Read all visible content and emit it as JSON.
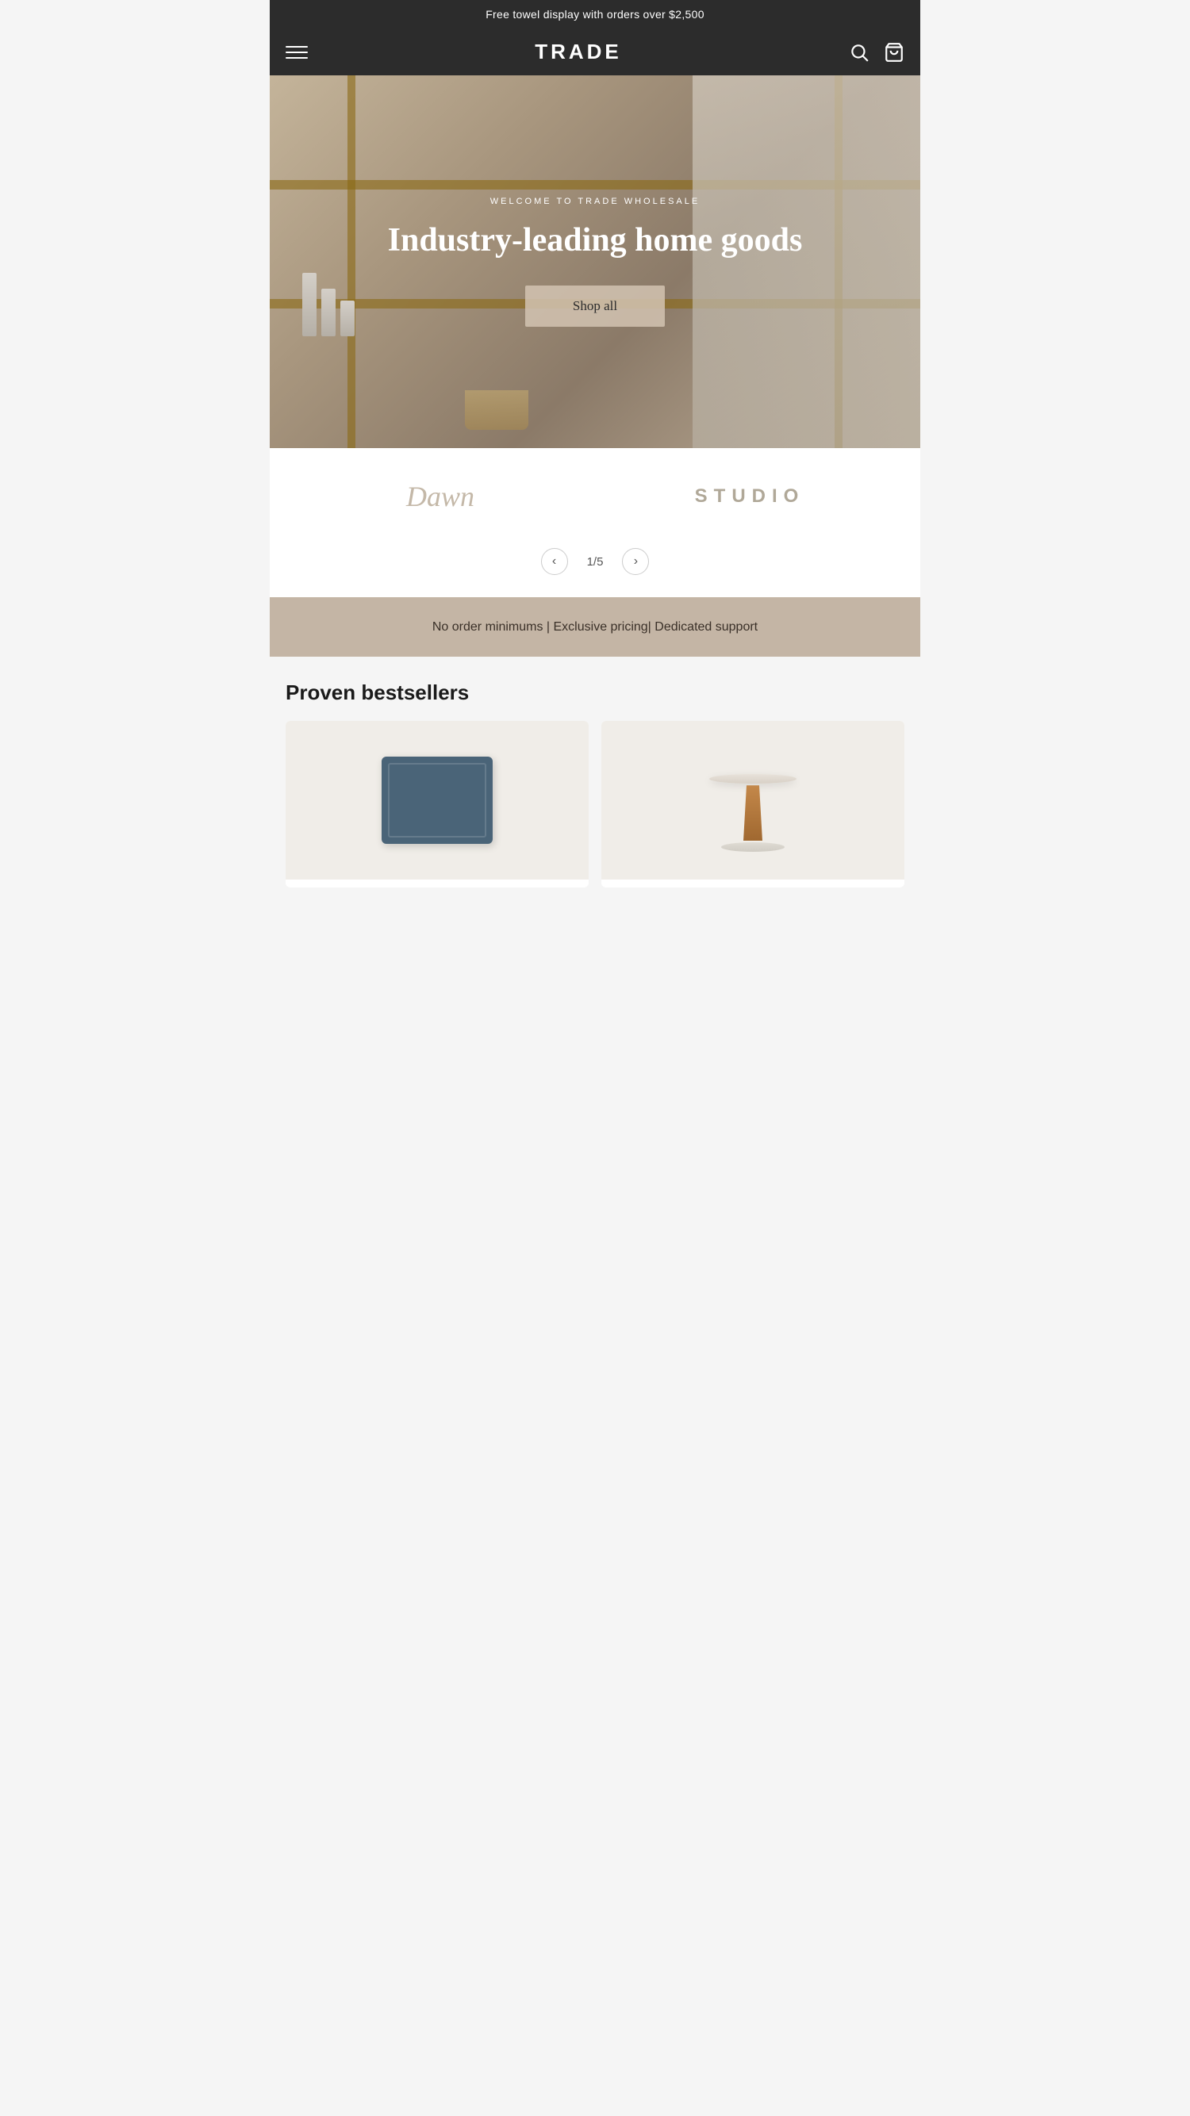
{
  "announcement": {
    "text": "Free towel display with orders over $2,500"
  },
  "header": {
    "logo": "TRADE",
    "menu_label": "Menu",
    "search_label": "Search",
    "cart_label": "Cart"
  },
  "hero": {
    "subtitle": "WELCOME TO TRADE WHOLESALE",
    "title": "Industry-leading home goods",
    "cta_label": "Shop all"
  },
  "brands": {
    "items": [
      {
        "name": "Dawn",
        "style": "dawn"
      },
      {
        "name": "STUDIO",
        "style": "studio"
      }
    ]
  },
  "pagination": {
    "prev_label": "‹",
    "next_label": "›",
    "current": "1",
    "total": "5",
    "display": "1/5"
  },
  "benefits": {
    "text": "No order minimums | Exclusive pricing| Dedicated support"
  },
  "bestsellers": {
    "title": "Proven bestsellers",
    "products": [
      {
        "id": 1,
        "type": "pillow",
        "alt": "Blue linen pillow"
      },
      {
        "id": 2,
        "type": "table",
        "alt": "Marble and wood side table"
      }
    ]
  }
}
